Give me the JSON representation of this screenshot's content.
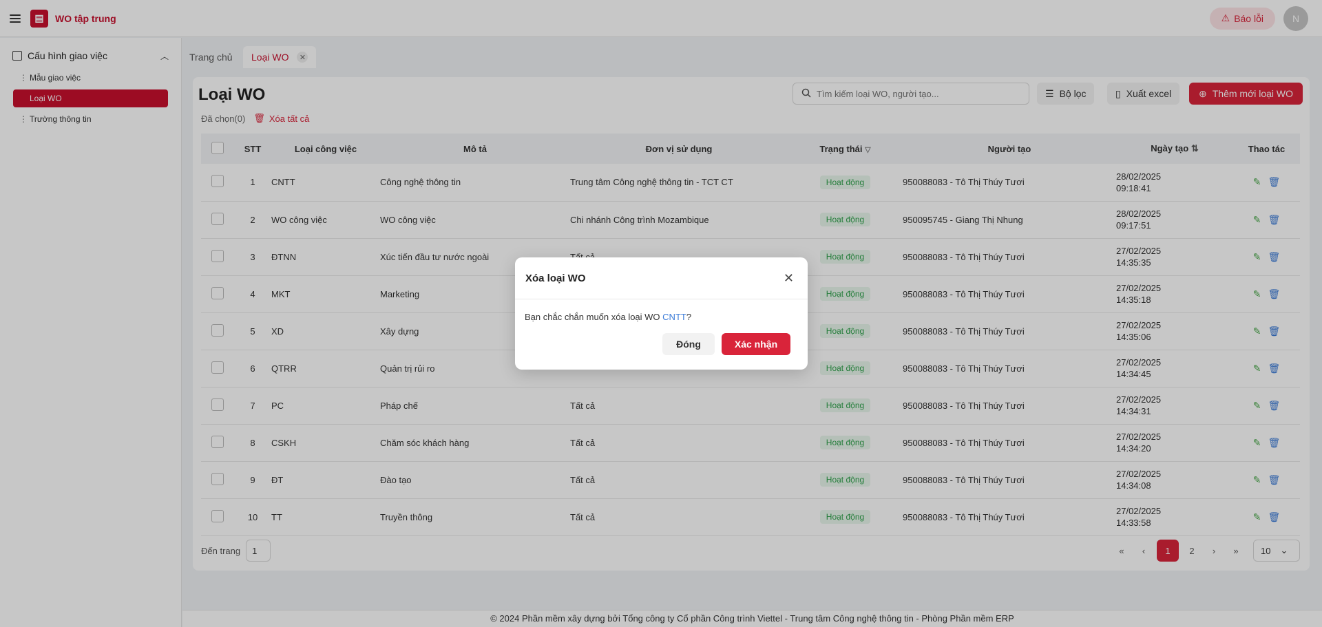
{
  "app": {
    "title": "WO tập trung",
    "report_label": "Báo lỗi",
    "avatar_letter": "N"
  },
  "sidebar": {
    "group_label": "Cấu hình giao việc",
    "items": [
      {
        "label": "Mẫu giao việc"
      },
      {
        "label": "Loại WO"
      },
      {
        "label": "Trường thông tin"
      }
    ]
  },
  "tabs": [
    {
      "label": "Trang chủ"
    },
    {
      "label": "Loại WO"
    }
  ],
  "page": {
    "title": "Loại WO",
    "search_placeholder": "Tìm kiếm loại WO, người tạo...",
    "filter_label": "Bộ lọc",
    "export_label": "Xuất excel",
    "add_label": "Thêm mới loại WO",
    "selected_label": "Đã chọn(0)",
    "delete_all_label": "Xóa tất cả"
  },
  "table": {
    "columns": [
      "STT",
      "Loại công việc",
      "Mô tả",
      "Đơn vị sử dụng",
      "Trạng thái",
      "Người tạo",
      "Ngày tạo",
      "Thao tác"
    ],
    "rows": [
      {
        "stt": "1",
        "code": "CNTT",
        "desc": "Công nghệ thông tin",
        "unit": "Trung tâm Công nghệ thông tin - TCT CT",
        "status": "Hoạt động",
        "creator": "950088083 - Tô Thị Thúy Tươi",
        "date": "28/02/2025",
        "time": "09:18:41"
      },
      {
        "stt": "2",
        "code": "WO công việc",
        "desc": "WO công việc",
        "unit": "Chi nhánh Công trình Mozambique",
        "status": "Hoạt động",
        "creator": "950095745 - Giang Thị Nhung",
        "date": "28/02/2025",
        "time": "09:17:51"
      },
      {
        "stt": "3",
        "code": "ĐTNN",
        "desc": "Xúc tiến đầu tư nước ngoài",
        "unit": "Tất cả",
        "status": "Hoạt động",
        "creator": "950088083 - Tô Thị Thúy Tươi",
        "date": "27/02/2025",
        "time": "14:35:35"
      },
      {
        "stt": "4",
        "code": "MKT",
        "desc": "Marketing",
        "unit": "",
        "status": "Hoạt động",
        "creator": "950088083 - Tô Thị Thúy Tươi",
        "date": "27/02/2025",
        "time": "14:35:18"
      },
      {
        "stt": "5",
        "code": "XD",
        "desc": "Xây dựng",
        "unit": "",
        "status": "Hoạt động",
        "creator": "950088083 - Tô Thị Thúy Tươi",
        "date": "27/02/2025",
        "time": "14:35:06"
      },
      {
        "stt": "6",
        "code": "QTRR",
        "desc": "Quản trị rủi ro",
        "unit": "",
        "status": "Hoạt động",
        "creator": "950088083 - Tô Thị Thúy Tươi",
        "date": "27/02/2025",
        "time": "14:34:45"
      },
      {
        "stt": "7",
        "code": "PC",
        "desc": "Pháp chế",
        "unit": "Tất cả",
        "status": "Hoạt động",
        "creator": "950088083 - Tô Thị Thúy Tươi",
        "date": "27/02/2025",
        "time": "14:34:31"
      },
      {
        "stt": "8",
        "code": "CSKH",
        "desc": "Chăm sóc khách hàng",
        "unit": "Tất cả",
        "status": "Hoạt động",
        "creator": "950088083 - Tô Thị Thúy Tươi",
        "date": "27/02/2025",
        "time": "14:34:20"
      },
      {
        "stt": "9",
        "code": "ĐT",
        "desc": "Đào tạo",
        "unit": "Tất cả",
        "status": "Hoạt động",
        "creator": "950088083 - Tô Thị Thúy Tươi",
        "date": "27/02/2025",
        "time": "14:34:08"
      },
      {
        "stt": "10",
        "code": "TT",
        "desc": "Truyền thông",
        "unit": "Tất cả",
        "status": "Hoạt động",
        "creator": "950088083 - Tô Thị Thúy Tươi",
        "date": "27/02/2025",
        "time": "14:33:58"
      }
    ]
  },
  "pagination": {
    "goto_label": "Đến trang",
    "goto_value": "1",
    "pages": [
      "1",
      "2"
    ],
    "page_size": "10"
  },
  "footer": {
    "text": "© 2024 Phần mềm xây dựng bởi Tổng công ty Cổ phần Công trình Viettel - Trung tâm Công nghệ thông tin - Phòng Phần mềm ERP"
  },
  "modal": {
    "title": "Xóa loại WO",
    "message_prefix": "Bạn chắc chắn muốn xóa loại WO ",
    "message_highlight": "CNTT",
    "message_suffix": "?",
    "close_label": "Đóng",
    "confirm_label": "Xác nhận"
  },
  "colors": {
    "brand": "#c8102e",
    "primary": "#d9243a",
    "status_active": "#2fa14b",
    "link": "#3b7bd8"
  },
  "icons": [
    "hamburger-icon",
    "logo-icon",
    "warning-icon",
    "form-icon",
    "chevron-up-icon",
    "drag-dots-icon",
    "close-icon",
    "search-icon",
    "filter-icon",
    "excel-icon",
    "plus-circle-icon",
    "trash-icon",
    "funnel-icon",
    "sort-icon",
    "edit-icon",
    "first-page-icon",
    "prev-page-icon",
    "next-page-icon",
    "last-page-icon",
    "chevron-down-icon"
  ]
}
